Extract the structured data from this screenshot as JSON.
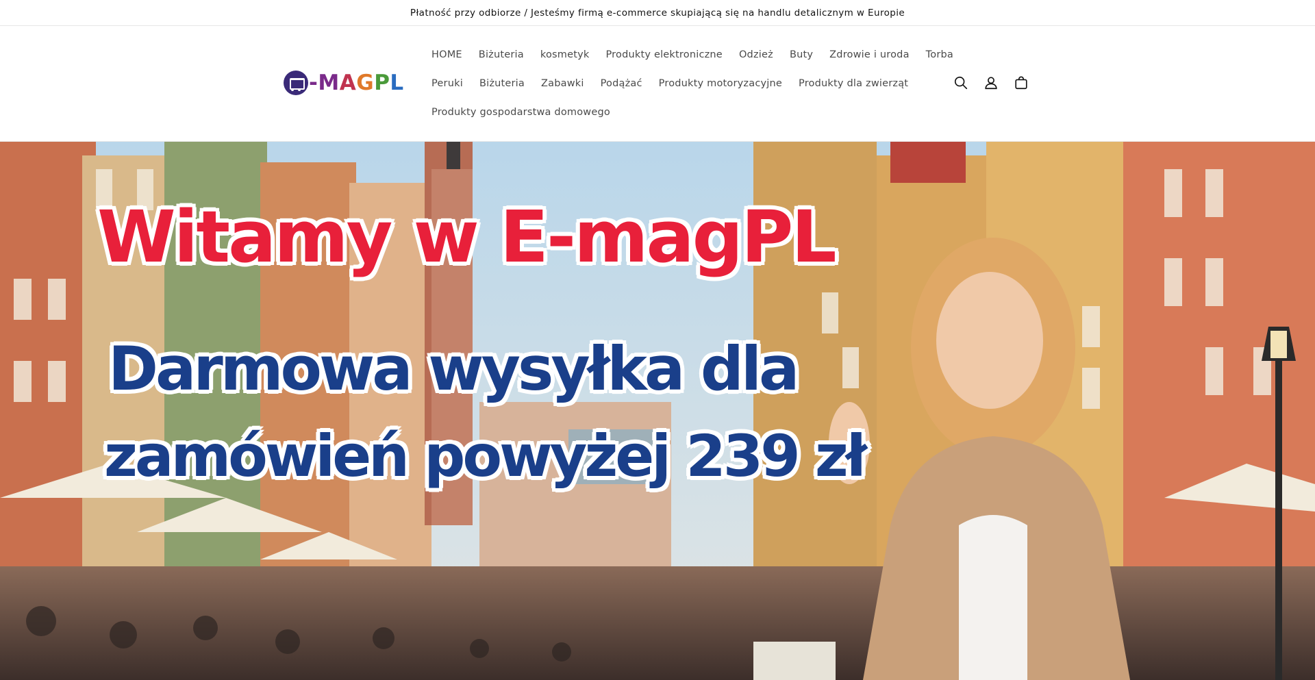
{
  "announcement": {
    "text": "Płatność przy odbiorze / Jesteśmy firmą e-commerce skupiającą się na handlu detalicznym w Europie"
  },
  "header": {
    "logo_alt": "E-MAGPL",
    "logo_letters": [
      "-",
      "M",
      "A",
      "G",
      "P",
      "L"
    ],
    "nav_row1": [
      "HOME",
      "Biżuteria",
      "kosmetyk",
      "Produkty elektroniczne",
      "Odzież",
      "Buty",
      "Zdrowie i uroda",
      "Torba"
    ],
    "nav_row2": [
      "Peruki",
      "Biżuteria",
      "Zabawki",
      "Podążać",
      "Produkty motoryzacyjne",
      "Produkty dla zwierząt"
    ],
    "nav_row3": [
      "Produkty gospodarstwa domowego"
    ],
    "icons": [
      "search-icon",
      "account-icon",
      "cart-icon"
    ]
  },
  "hero": {
    "title": "Witamy w E-magPL",
    "line1": "Darmowa wysyłka dla",
    "line2": "zamówień powyżej 239 zł"
  },
  "colors": {
    "title_red": "#e8203a",
    "text_blue": "#1a3f8a",
    "nav_text": "#4a4a4a"
  }
}
